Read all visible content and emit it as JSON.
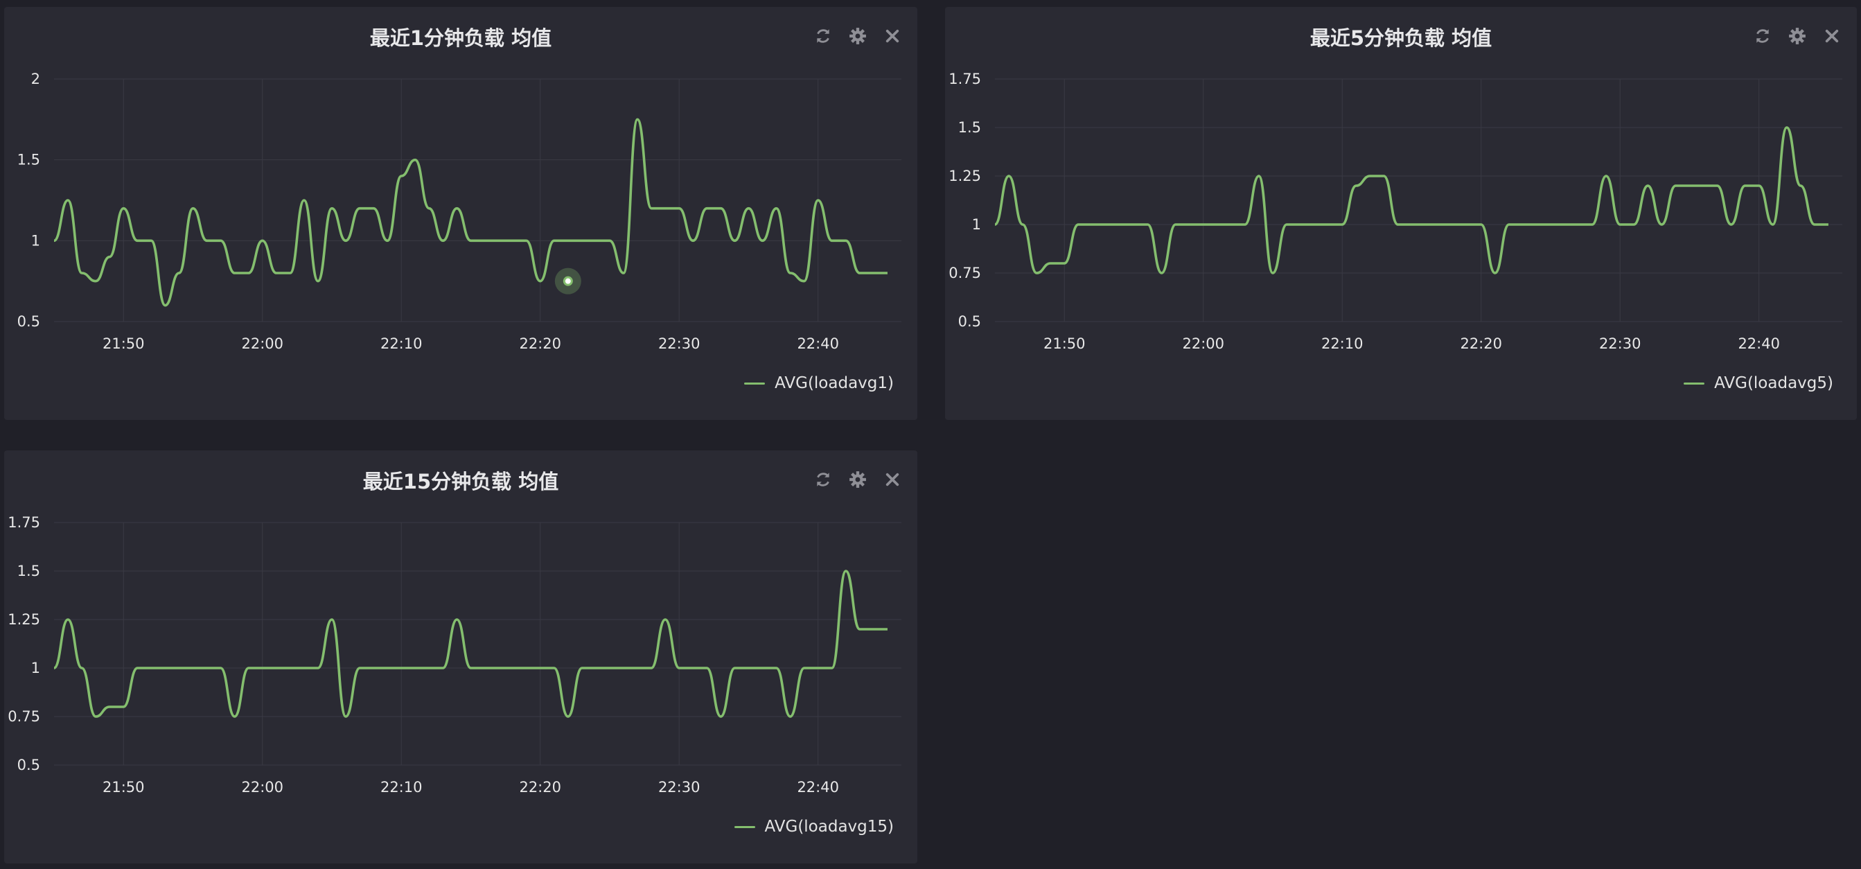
{
  "colors": {
    "series": "#84be6e",
    "background": "#202028",
    "panel": "#2a2a33",
    "grid": "#3a3a44"
  },
  "icons": {
    "refresh": "refresh-icon",
    "settings": "gear-icon",
    "close": "close-icon"
  },
  "panels": [
    {
      "title": "最近1分钟负载 均值",
      "legend": "AVG(loadavg1)",
      "chart_data": {
        "type": "line",
        "x_ticks": [
          "21:50",
          "22:00",
          "22:10",
          "22:20",
          "22:30",
          "22:40"
        ],
        "y_ticks": [
          "0.5",
          "1",
          "1.5",
          "2"
        ],
        "ylim": [
          0.5,
          2
        ],
        "xlim": [
          "21:45",
          "22:46"
        ],
        "grid": true,
        "highlighted_point": {
          "x": "22:22",
          "y": 0.75
        },
        "series": [
          {
            "name": "AVG(loadavg1)",
            "x": [
              "21:45",
              "21:46",
              "21:47",
              "21:48",
              "21:49",
              "21:50",
              "21:51",
              "21:52",
              "21:53",
              "21:54",
              "21:55",
              "21:56",
              "21:57",
              "21:58",
              "21:59",
              "22:00",
              "22:01",
              "22:02",
              "22:03",
              "22:04",
              "22:05",
              "22:06",
              "22:07",
              "22:08",
              "22:09",
              "22:10",
              "22:11",
              "22:12",
              "22:13",
              "22:14",
              "22:15",
              "22:16",
              "22:17",
              "22:18",
              "22:19",
              "22:20",
              "22:21",
              "22:22",
              "22:23",
              "22:24",
              "22:25",
              "22:26",
              "22:27",
              "22:28",
              "22:29",
              "22:30",
              "22:31",
              "22:32",
              "22:33",
              "22:34",
              "22:35",
              "22:36",
              "22:37",
              "22:38",
              "22:39",
              "22:40",
              "22:41",
              "22:42",
              "22:43",
              "22:44",
              "22:45"
            ],
            "values": [
              1,
              1.25,
              0.8,
              0.75,
              0.9,
              1.2,
              1,
              1,
              0.6,
              0.8,
              1.2,
              1,
              1,
              0.8,
              0.8,
              1,
              0.8,
              0.8,
              1.25,
              0.75,
              1.2,
              1,
              1.2,
              1.2,
              1,
              1.4,
              1.5,
              1.2,
              1,
              1.2,
              1,
              1,
              1,
              1,
              1,
              0.75,
              1,
              1,
              1,
              1,
              1,
              0.8,
              1.75,
              1.2,
              1.2,
              1.2,
              1,
              1.2,
              1.2,
              1,
              1.2,
              1,
              1.2,
              0.8,
              0.75,
              1.25,
              1,
              1,
              0.8,
              0.8,
              0.8
            ]
          }
        ]
      }
    },
    {
      "title": "最近5分钟负载 均值",
      "legend": "AVG(loadavg5)",
      "chart_data": {
        "type": "line",
        "x_ticks": [
          "21:50",
          "22:00",
          "22:10",
          "22:20",
          "22:30",
          "22:40"
        ],
        "y_ticks": [
          "0.5",
          "0.75",
          "1",
          "1.25",
          "1.5",
          "1.75"
        ],
        "ylim": [
          0.5,
          1.75
        ],
        "xlim": [
          "21:45",
          "22:46"
        ],
        "grid": true,
        "series": [
          {
            "name": "AVG(loadavg5)",
            "x": [
              "21:45",
              "21:46",
              "21:47",
              "21:48",
              "21:49",
              "21:50",
              "21:51",
              "21:52",
              "21:53",
              "21:54",
              "21:55",
              "21:56",
              "21:57",
              "21:58",
              "21:59",
              "22:00",
              "22:01",
              "22:02",
              "22:03",
              "22:04",
              "22:05",
              "22:06",
              "22:07",
              "22:08",
              "22:09",
              "22:10",
              "22:11",
              "22:12",
              "22:13",
              "22:14",
              "22:15",
              "22:16",
              "22:17",
              "22:18",
              "22:19",
              "22:20",
              "22:21",
              "22:22",
              "22:23",
              "22:24",
              "22:25",
              "22:26",
              "22:27",
              "22:28",
              "22:29",
              "22:30",
              "22:31",
              "22:32",
              "22:33",
              "22:34",
              "22:35",
              "22:36",
              "22:37",
              "22:38",
              "22:39",
              "22:40",
              "22:41",
              "22:42",
              "22:43",
              "22:44",
              "22:45"
            ],
            "values": [
              1,
              1.25,
              1,
              0.75,
              0.8,
              0.8,
              1,
              1,
              1,
              1,
              1,
              1,
              0.75,
              1,
              1,
              1,
              1,
              1,
              1,
              1.25,
              0.75,
              1,
              1,
              1,
              1,
              1,
              1.2,
              1.25,
              1.25,
              1,
              1,
              1,
              1,
              1,
              1,
              1,
              0.75,
              1,
              1,
              1,
              1,
              1,
              1,
              1,
              1.25,
              1,
              1,
              1.2,
              1,
              1.2,
              1.2,
              1.2,
              1.2,
              1,
              1.2,
              1.2,
              1,
              1.5,
              1.2,
              1,
              1
            ]
          }
        ]
      }
    },
    {
      "title": "最近15分钟负载 均值",
      "legend": "AVG(loadavg15)",
      "chart_data": {
        "type": "line",
        "x_ticks": [
          "21:50",
          "22:00",
          "22:10",
          "22:20",
          "22:30",
          "22:40"
        ],
        "y_ticks": [
          "0.5",
          "0.75",
          "1",
          "1.25",
          "1.5",
          "1.75"
        ],
        "ylim": [
          0.5,
          1.75
        ],
        "xlim": [
          "21:45",
          "22:46"
        ],
        "grid": true,
        "series": [
          {
            "name": "AVG(loadavg15)",
            "x": [
              "21:45",
              "21:46",
              "21:47",
              "21:48",
              "21:49",
              "21:50",
              "21:51",
              "21:52",
              "21:53",
              "21:54",
              "21:55",
              "21:56",
              "21:57",
              "21:58",
              "21:59",
              "22:00",
              "22:01",
              "22:02",
              "22:03",
              "22:04",
              "22:05",
              "22:06",
              "22:07",
              "22:08",
              "22:09",
              "22:10",
              "22:11",
              "22:12",
              "22:13",
              "22:14",
              "22:15",
              "22:16",
              "22:17",
              "22:18",
              "22:19",
              "22:20",
              "22:21",
              "22:22",
              "22:23",
              "22:24",
              "22:25",
              "22:26",
              "22:27",
              "22:28",
              "22:29",
              "22:30",
              "22:31",
              "22:32",
              "22:33",
              "22:34",
              "22:35",
              "22:36",
              "22:37",
              "22:38",
              "22:39",
              "22:40",
              "22:41",
              "22:42",
              "22:43",
              "22:44",
              "22:45"
            ],
            "values": [
              1,
              1.25,
              1,
              0.75,
              0.8,
              0.8,
              1,
              1,
              1,
              1,
              1,
              1,
              1,
              0.75,
              1,
              1,
              1,
              1,
              1,
              1,
              1.25,
              0.75,
              1,
              1,
              1,
              1,
              1,
              1,
              1,
              1.25,
              1,
              1,
              1,
              1,
              1,
              1,
              1,
              0.75,
              1,
              1,
              1,
              1,
              1,
              1,
              1.25,
              1,
              1,
              1,
              0.75,
              1,
              1,
              1,
              1,
              0.75,
              1,
              1,
              1,
              1.5,
              1.2,
              1.2,
              1.2
            ]
          }
        ]
      }
    }
  ]
}
